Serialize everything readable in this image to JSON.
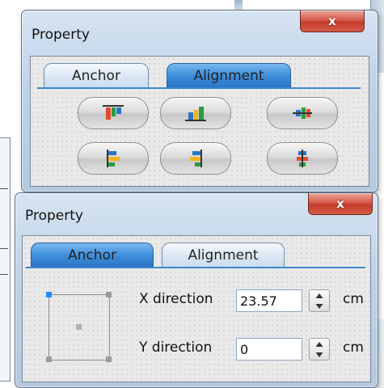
{
  "window_top": {
    "title": "Property",
    "close_glyph": "x",
    "tabs": [
      {
        "label": "Anchor",
        "active": false
      },
      {
        "label": "Alignment",
        "active": true
      }
    ],
    "buttons": [
      {
        "name": "align-top-button",
        "icon": "align-top-icon"
      },
      {
        "name": "align-bottom-button",
        "icon": "align-bottom-icon"
      },
      {
        "name": "align-vertical-center-button",
        "icon": "align-vertical-center-icon"
      },
      {
        "name": "align-left-button",
        "icon": "align-left-icon"
      },
      {
        "name": "align-right-button",
        "icon": "align-right-icon"
      },
      {
        "name": "align-horizontal-center-button",
        "icon": "align-horizontal-center-icon"
      }
    ]
  },
  "window_bottom": {
    "title": "Property",
    "close_glyph": "x",
    "tabs": [
      {
        "label": "Anchor",
        "active": true
      },
      {
        "label": "Alignment",
        "active": false
      }
    ],
    "x_label": "X direction",
    "x_value": "23.57",
    "x_unit": "cm",
    "y_label": "Y direction",
    "y_value": "0",
    "y_unit": "cm"
  },
  "colors": {
    "active_tab": "#3d8edb",
    "close_button": "#d7594a",
    "anchor_selected": "#1e90ff"
  }
}
